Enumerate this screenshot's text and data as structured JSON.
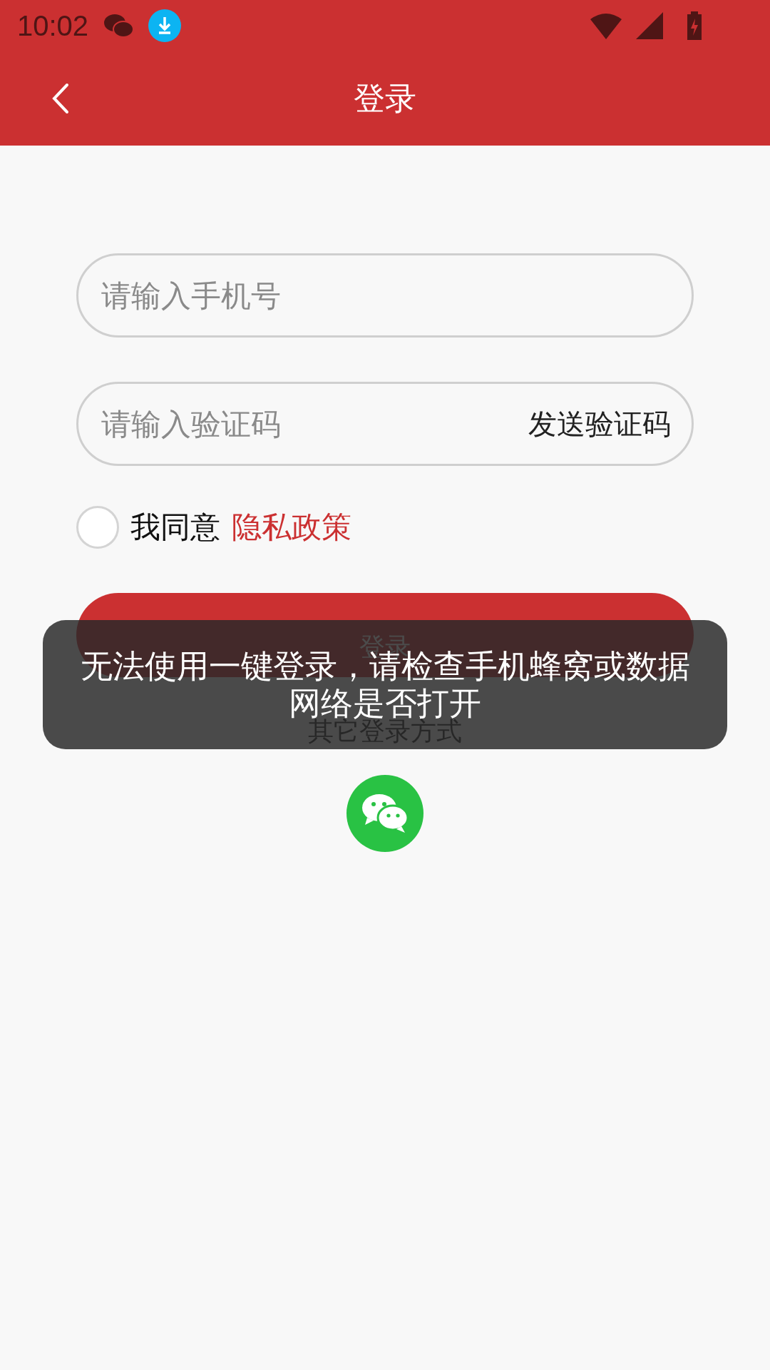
{
  "status_bar": {
    "time": "10:02"
  },
  "app_bar": {
    "title": "登录"
  },
  "phone_field": {
    "placeholder": "请输入手机号"
  },
  "code_field": {
    "placeholder": "请输入验证码",
    "action": "发送验证码"
  },
  "agreement": {
    "checked": false,
    "text": "我同意",
    "link": "隐私政策"
  },
  "login_button": {
    "label": "登录"
  },
  "other_login": {
    "title": "其它登录方式"
  },
  "toast": {
    "message": "无法使用一键登录，请检查手机蜂窝或数据网络是否打开"
  }
}
